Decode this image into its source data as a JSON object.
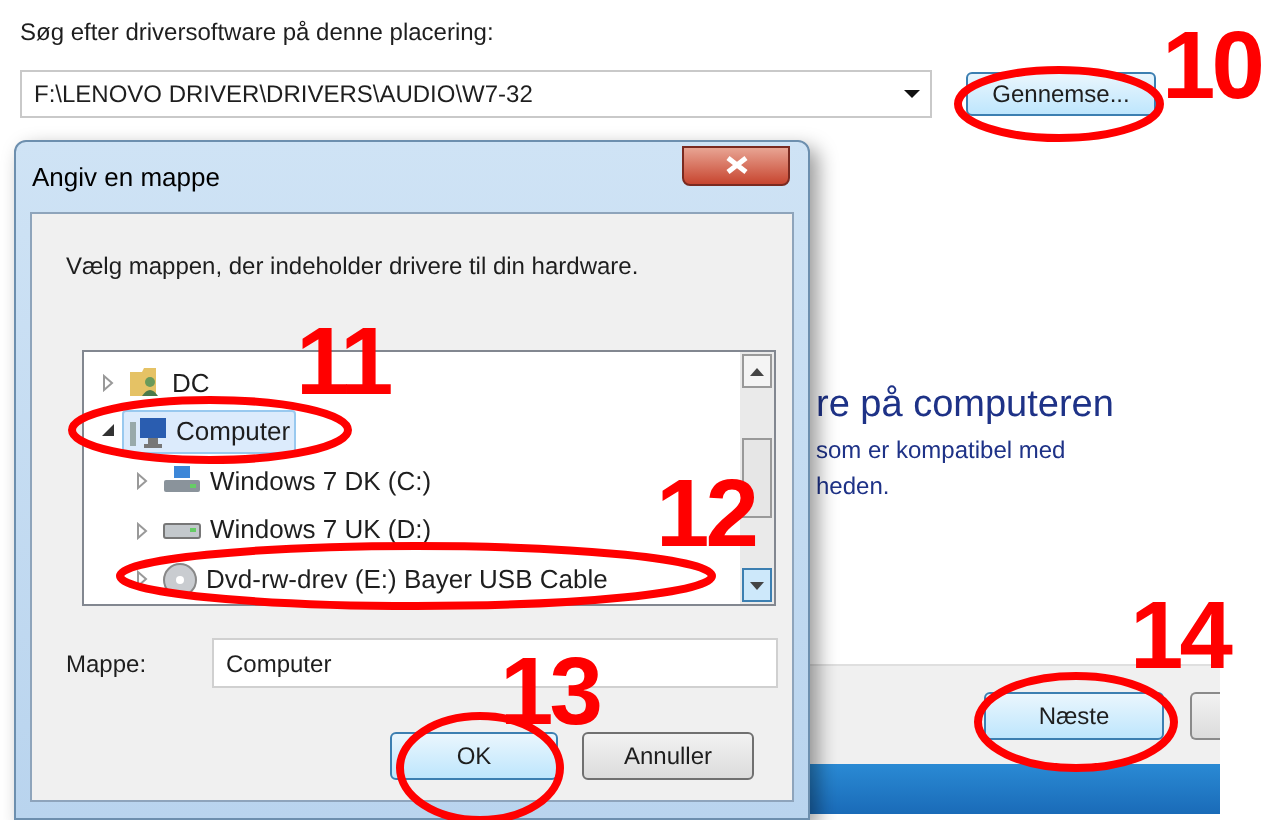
{
  "page": {
    "instruction": "Søg efter driversoftware på denne placering:",
    "path": "F:\\LENOVO DRIVER\\DRIVERS\\AUDIO\\W7-32",
    "browse_button": "Gennemse...",
    "heading": "re på computeren",
    "description": [
      "som er kompatibel med",
      "heden."
    ],
    "next_button": "Næste"
  },
  "dialog": {
    "title": "Angiv en mappe",
    "instruction": "Vælg mappen, der indeholder drivere til din hardware.",
    "tree": [
      {
        "label": "DC",
        "kind": "user-folder",
        "expanded": false,
        "selected": false
      },
      {
        "label": "Computer",
        "kind": "computer",
        "expanded": true,
        "selected": true,
        "children": [
          {
            "label": "Windows 7 DK (C:)",
            "kind": "system-drive",
            "expanded": false,
            "selected": false
          },
          {
            "label": "Windows 7 UK (D:)",
            "kind": "drive",
            "expanded": false,
            "selected": false
          },
          {
            "label": "Dvd-rw-drev (E:) Bayer USB Cable",
            "kind": "dvd",
            "expanded": false,
            "selected": false
          }
        ]
      }
    ],
    "folder_label": "Mappe:",
    "folder_value": "Computer",
    "ok_button": "OK",
    "cancel_button": "Annuller"
  },
  "annotations": [
    {
      "number": "10"
    },
    {
      "number": "11"
    },
    {
      "number": "12"
    },
    {
      "number": "13"
    },
    {
      "number": "14"
    }
  ]
}
